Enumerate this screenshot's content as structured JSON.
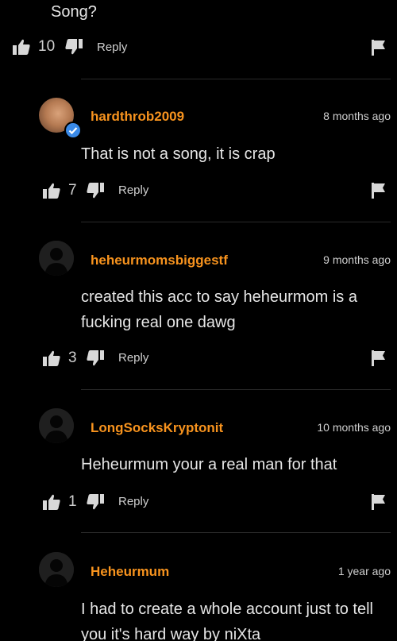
{
  "top": {
    "text": "Song?",
    "likes": "10",
    "reply": "Reply"
  },
  "comments": [
    {
      "username": "hardthrob2009",
      "time": "8 months ago",
      "text": "That is not a song, it is crap",
      "likes": "7",
      "reply": "Reply",
      "verified": true
    },
    {
      "username": "heheurmomsbiggestf",
      "time": "9 months ago",
      "text": "created this acc to say heheurmom is a fucking real one dawg",
      "likes": "3",
      "reply": "Reply"
    },
    {
      "username": "LongSocksKryptonit",
      "time": "10 months ago",
      "text": "Heheurmum your a real man for that",
      "likes": "1",
      "reply": "Reply"
    },
    {
      "username": "Heheurmum",
      "time": "1 year ago",
      "text": "I had to create a whole account just to tell you it's hard way by niXta"
    }
  ],
  "colors": {
    "background": "#000000",
    "username": "#f7931e",
    "text": "#e6e6e6",
    "verified": "#3a8ae8"
  },
  "icons": [
    "thumbs-up-icon",
    "thumbs-down-icon",
    "flag-icon",
    "verified-check-icon",
    "default-avatar-icon"
  ]
}
